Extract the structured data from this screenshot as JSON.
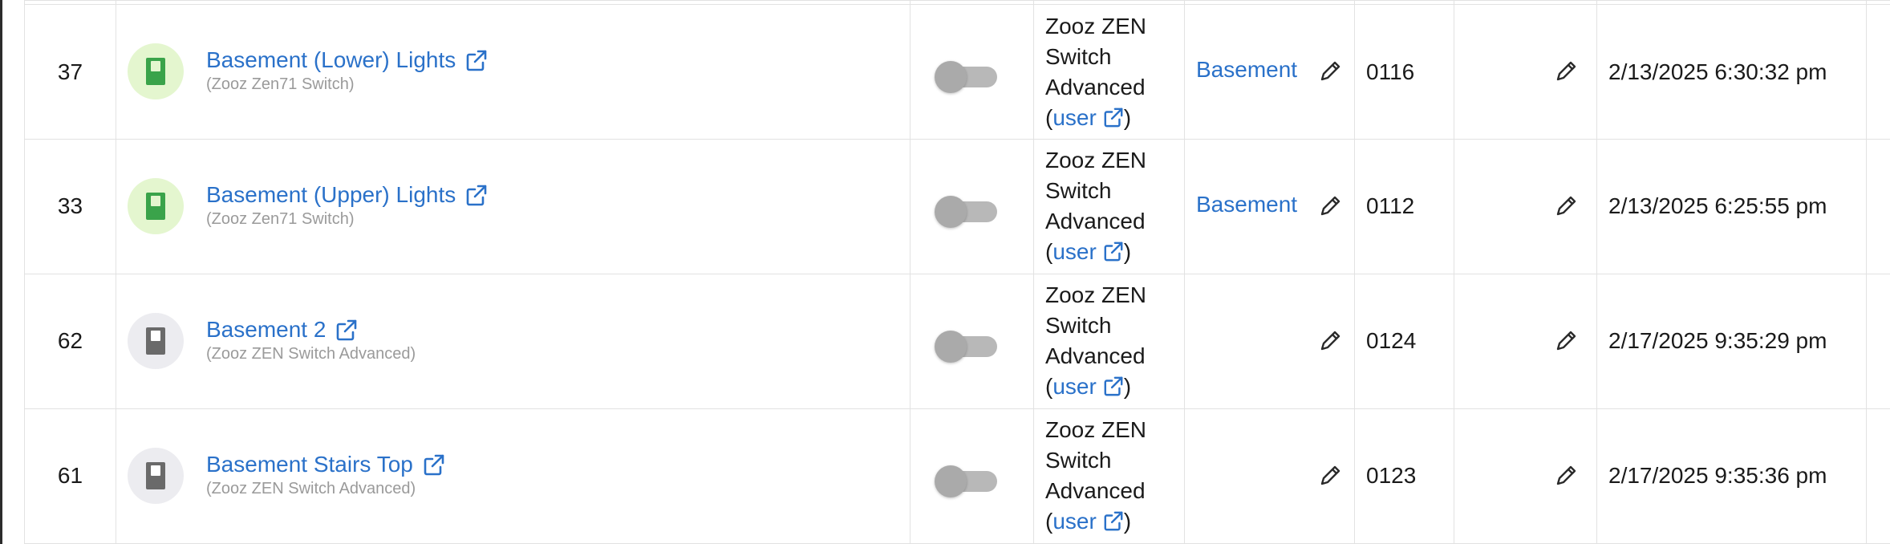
{
  "rows": [
    {
      "id": "37",
      "name": "Basement (Lower) Lights",
      "type": "(Zooz Zen71 Switch)",
      "state": "on",
      "driver": [
        "Zooz ZEN",
        "Switch",
        "Advanced"
      ],
      "driver_source": "user",
      "room": "Basement",
      "dni": "0116",
      "last_activity": "2/13/2025 6:30:32 pm"
    },
    {
      "id": "33",
      "name": "Basement (Upper) Lights",
      "type": "(Zooz Zen71 Switch)",
      "state": "on",
      "driver": [
        "Zooz ZEN",
        "Switch",
        "Advanced"
      ],
      "driver_source": "user",
      "room": "Basement",
      "dni": "0112",
      "last_activity": "2/13/2025 6:25:55 pm"
    },
    {
      "id": "62",
      "name": "Basement 2",
      "type": "(Zooz ZEN Switch Advanced)",
      "state": "off",
      "driver": [
        "Zooz ZEN",
        "Switch",
        "Advanced"
      ],
      "driver_source": "user",
      "room": "",
      "dni": "0124",
      "last_activity": "2/17/2025 9:35:29 pm"
    },
    {
      "id": "61",
      "name": "Basement Stairs Top",
      "type": "(Zooz ZEN Switch Advanced)",
      "state": "off",
      "driver": [
        "Zooz ZEN",
        "Switch",
        "Advanced"
      ],
      "driver_source": "user",
      "room": "",
      "dni": "0123",
      "last_activity": "2/17/2025 9:35:36 pm"
    }
  ],
  "punctuation": {
    "open_paren": "(",
    "close_paren": ")"
  },
  "icons": {
    "switch_on": "switch-icon-green",
    "switch_off": "switch-icon-gray",
    "external_link": "external-link-icon",
    "edit": "pencil-icon"
  },
  "colors": {
    "link": "#2a71c9",
    "switch_on_bg": "#e4f6cf",
    "switch_on_fg": "#3aa34a",
    "switch_off_bg": "#ececf0",
    "switch_off_fg": "#6a6a6a"
  }
}
